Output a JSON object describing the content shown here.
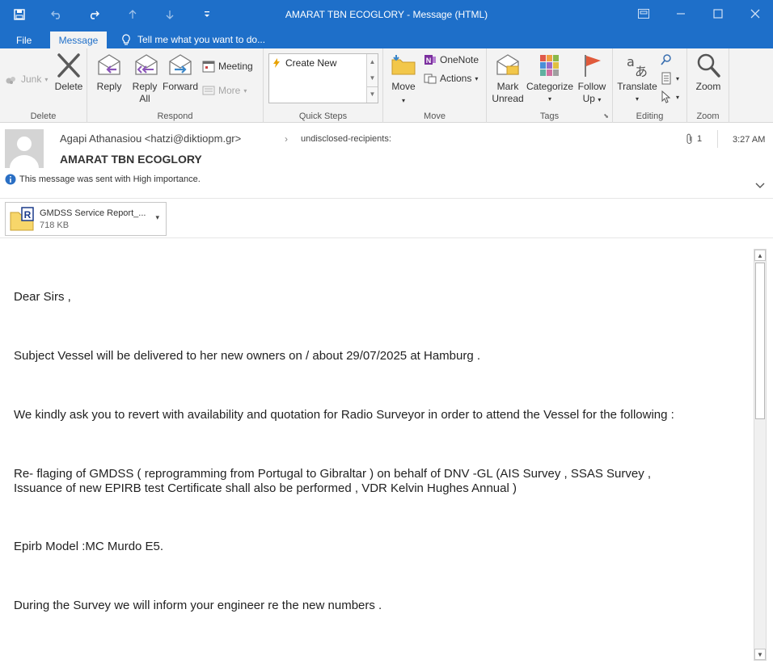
{
  "window": {
    "title": "AMARAT TBN ECOGLORY - Message (HTML)"
  },
  "tabs": [
    {
      "label": "File"
    },
    {
      "label": "Message"
    }
  ],
  "tellme": {
    "text": "Tell me what you want to do..."
  },
  "ribbon": {
    "delete_group": {
      "label": "Delete",
      "junk": "Junk",
      "delete": "Delete"
    },
    "respond_group": {
      "label": "Respond",
      "reply": "Reply",
      "reply_all_1": "Reply",
      "reply_all_2": "All",
      "forward": "Forward",
      "meeting": "Meeting",
      "more": "More"
    },
    "quicksteps_group": {
      "label": "Quick Steps",
      "create_new": "Create New"
    },
    "move_group": {
      "label": "Move",
      "move": "Move",
      "onenote": "OneNote",
      "actions": "Actions"
    },
    "tags_group": {
      "label": "Tags",
      "mark_unread_1": "Mark",
      "mark_unread_2": "Unread",
      "categorize": "Categorize",
      "follow_up_1": "Follow",
      "follow_up_2": "Up"
    },
    "editing_group": {
      "label": "Editing",
      "translate": "Translate"
    },
    "zoom_group": {
      "label": "Zoom",
      "zoom": "Zoom"
    }
  },
  "message": {
    "sender": "Agapi Athanasiou <hatzi@diktiopm.gr>",
    "recipients": "undisclosed-recipients:",
    "subject": "AMARAT TBN ECOGLORY",
    "importance": "This message was sent with High importance.",
    "attachment_count": "1",
    "time": "3:27 AM",
    "attachment": {
      "name": "GMDSS Service Report_...",
      "size": "718 KB"
    }
  },
  "body": {
    "p1": "Dear Sirs ,",
    "p2": "Subject Vessel will be delivered to her new owners on / about 29/07/2025 at Hamburg .",
    "p3": "We kindly ask you to revert with availability and quotation for Radio Surveyor in order to attend the Vessel for the following :",
    "p4a": "Re- flaging of GMDSS ( reprogramming from Portugal to Gibraltar ) on behalf of DNV -GL (AIS Survey , SSAS Survey ,",
    "p4b": "Issuance of new EPIRB test Certificate  shall also be performed , VDR Kelvin Hughes Annual )",
    "p5": "Epirb Model :MC Murdo E5.",
    "p6": "During the Survey we will inform your engineer re the new numbers ."
  }
}
